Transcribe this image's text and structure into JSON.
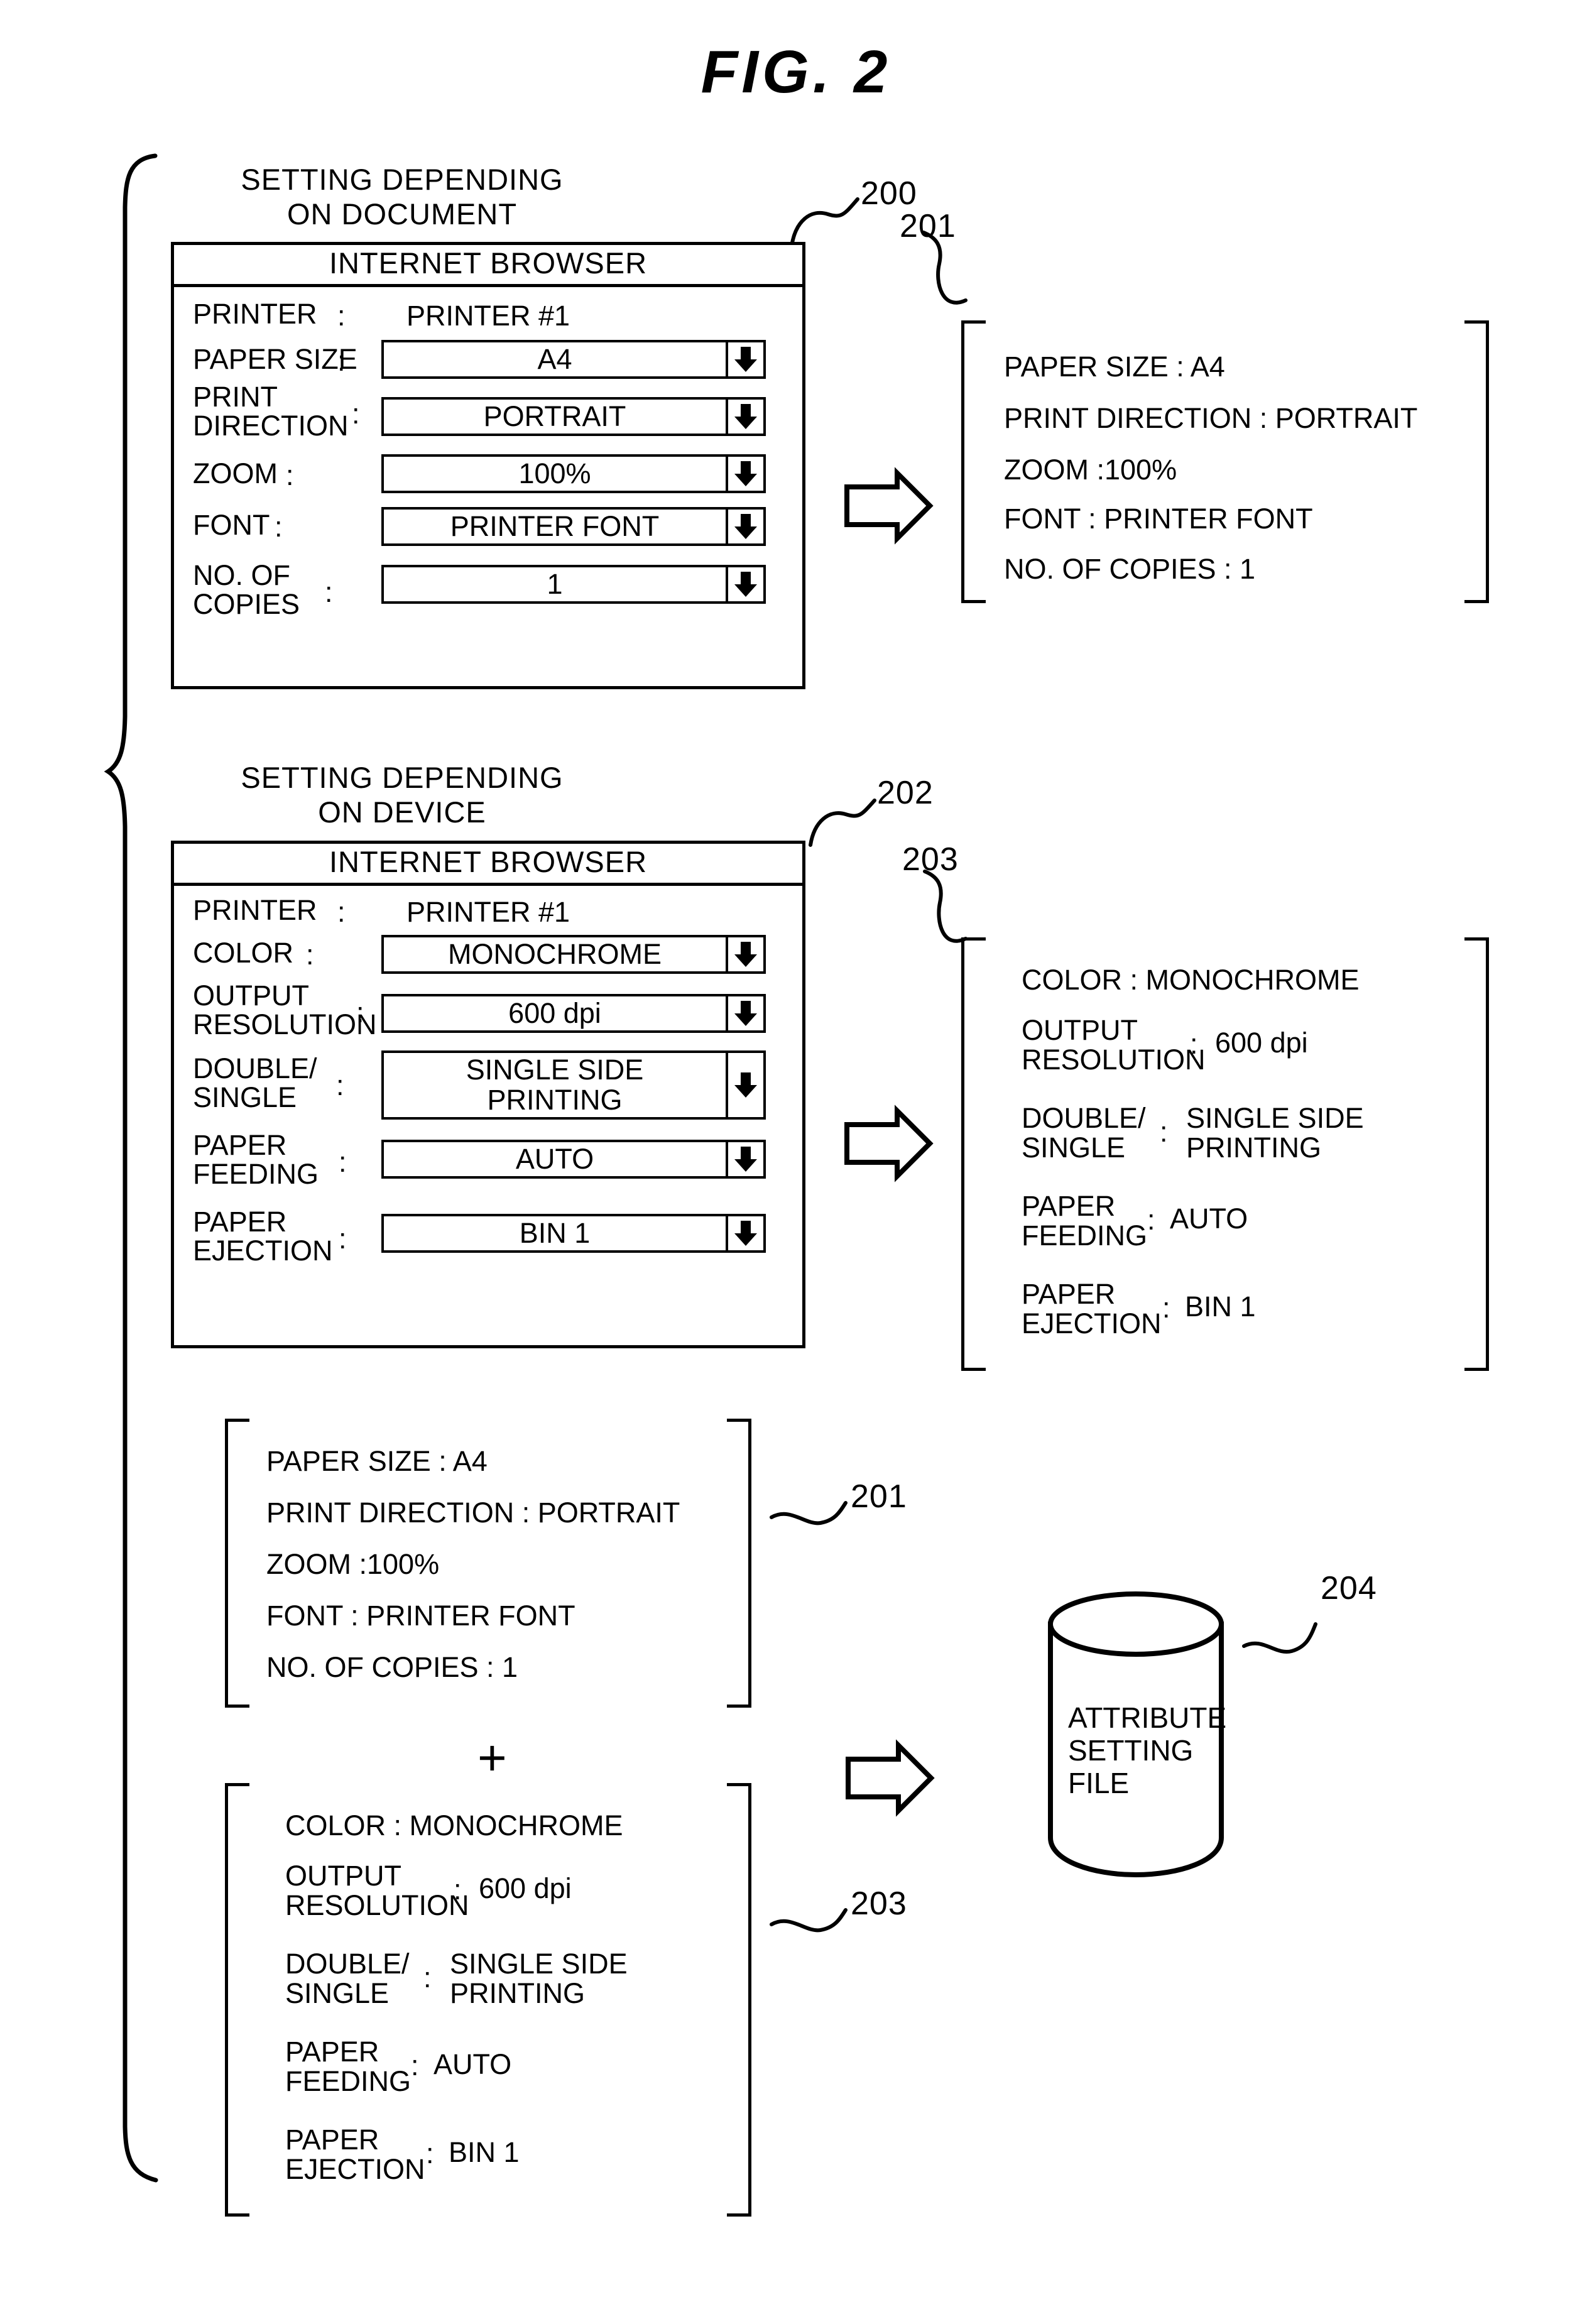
{
  "figure": {
    "title": "FIG. 2"
  },
  "sections": {
    "document": {
      "caption_line1": "SETTING DEPENDING",
      "caption_line2": "ON DOCUMENT",
      "ref": "200",
      "dialog": {
        "title": "INTERNET BROWSER",
        "printer_label": "PRINTER",
        "printer_colon": ":",
        "printer_value": "PRINTER #1",
        "rows": [
          {
            "label": "PAPER SIZE",
            "colon": ":",
            "value": "A4"
          },
          {
            "label_line1": "PRINT",
            "label_line2": "DIRECTION",
            "colon": ":",
            "value": "PORTRAIT"
          },
          {
            "label": "ZOOM",
            "colon": ":",
            "value": "100%"
          },
          {
            "label": "FONT",
            "colon": ":",
            "value": "PRINTER FONT"
          },
          {
            "label_line1": "NO. OF",
            "label_line2": "COPIES",
            "colon": ":",
            "value": "1"
          }
        ]
      }
    },
    "device": {
      "caption_line1": "SETTING DEPENDING",
      "caption_line2": "ON DEVICE",
      "ref": "202",
      "dialog": {
        "title": "INTERNET BROWSER",
        "printer_label": "PRINTER",
        "printer_colon": ":",
        "printer_value": "PRINTER #1",
        "rows": [
          {
            "label": "COLOR",
            "colon": ":",
            "value": "MONOCHROME"
          },
          {
            "label_line1": "OUTPUT",
            "label_line2": "RESOLUTION",
            "colon": ":",
            "value": "600 dpi"
          },
          {
            "label_line1": "DOUBLE/",
            "label_line2": "SINGLE",
            "colon": ":",
            "value_line1": "SINGLE SIDE",
            "value_line2": "PRINTING"
          },
          {
            "label_line1": "PAPER",
            "label_line2": "FEEDING",
            "colon": ":",
            "value": "AUTO"
          },
          {
            "label_line1": "PAPER",
            "label_line2": "EJECTION",
            "colon": ":",
            "value": "BIN 1"
          }
        ]
      }
    }
  },
  "attr_document": {
    "ref": "201",
    "lines": [
      "PAPER SIZE : A4",
      "PRINT DIRECTION : PORTRAIT",
      "ZOOM :100%",
      "FONT : PRINTER FONT",
      "NO. OF COPIES : 1"
    ]
  },
  "attr_device": {
    "ref": "203",
    "line1": "COLOR : MONOCHROME",
    "rows": [
      {
        "key_line1": "OUTPUT",
        "key_line2": "RESOLUTION",
        "colon": ":",
        "value": "600 dpi"
      },
      {
        "key_line1": "DOUBLE/",
        "key_line2": "SINGLE",
        "colon": ":",
        "value_line1": "SINGLE SIDE",
        "value_line2": "PRINTING"
      },
      {
        "key_line1": "PAPER",
        "key_line2": "FEEDING",
        "colon": ":",
        "value": "AUTO"
      },
      {
        "key_line1": "PAPER",
        "key_line2": "EJECTION",
        "colon": ":",
        "value": "BIN 1"
      }
    ]
  },
  "combine": {
    "plus": "+"
  },
  "storage": {
    "ref": "204",
    "label_line1": "ATTRIBUTE",
    "label_line2": "SETTING",
    "label_line3": "FILE"
  }
}
